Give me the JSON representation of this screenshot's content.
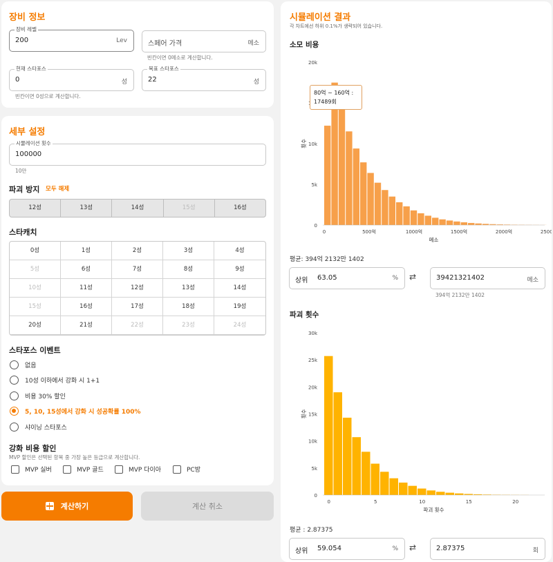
{
  "equip": {
    "title": "장비 정보",
    "level": {
      "label": "장비 레벨",
      "value": "200",
      "unit": "Lev"
    },
    "spare": {
      "placeholder": "스페어 가격",
      "unit": "메소",
      "helper": "빈칸이면 0메소로 계산합니다."
    },
    "current": {
      "label": "현재 스타포스",
      "value": "0",
      "unit": "성",
      "helper": "빈칸이면 0성으로 계산합니다."
    },
    "target": {
      "label": "목표 스타포스",
      "value": "22",
      "unit": "성"
    }
  },
  "detail": {
    "title": "세부 설정",
    "sim_count": {
      "label": "시뮬레이션 횟수",
      "value": "100000",
      "helper": "10만"
    },
    "protect": {
      "title": "파괴 방지",
      "clear_all": "모두 해제",
      "items": [
        "12성",
        "13성",
        "14성",
        "15성",
        "16성"
      ]
    },
    "starcatch": {
      "title": "스타캐치",
      "items": [
        "0성",
        "1성",
        "2성",
        "3성",
        "4성",
        "5성",
        "6성",
        "7성",
        "8성",
        "9성",
        "10성",
        "11성",
        "12성",
        "13성",
        "14성",
        "15성",
        "16성",
        "17성",
        "18성",
        "19성",
        "20성",
        "21성",
        "22성",
        "23성",
        "24성"
      ]
    },
    "event": {
      "title": "스타포스 이벤트",
      "options": [
        "없음",
        "10성 이하에서 강화 시 1+1",
        "비용 30% 할인",
        "5, 10, 15성에서 강화 시 성공확률 100%",
        "샤이닝 스타포스"
      ],
      "selected_index": 3
    },
    "discount": {
      "title": "강화 비용 할인",
      "helper": "MVP 할인은 선택된 항목 중 가장 높은 등급으로 계산합니다.",
      "options": [
        "MVP 실버",
        "MVP 골드",
        "MVP 다이아",
        "PC방"
      ]
    }
  },
  "actions": {
    "calc": "계산하기",
    "cancel": "계산 취소"
  },
  "colors": {
    "accent": "#f57c00",
    "cost_bar": "#f7a04a",
    "destroy_bar": "#ffb300"
  },
  "results": {
    "title": "시뮬레이션 결과",
    "subtitle": "각 차트에선 하위 0.1%가 생략되어 있습니다.",
    "cost": {
      "title": "소모 비용",
      "mean": "평균: 394억 2132만 1402",
      "percentile_label": "상위",
      "percentile": "63.05",
      "percentile_unit": "%",
      "value": "39421321402",
      "value_unit": "메소",
      "value_helper": "394억 2132만 1402",
      "tooltip_line1": "80억 ~ 160억 :",
      "tooltip_line2": "17489회"
    },
    "destroy": {
      "title": "파괴 횟수",
      "mean": "평균 : 2.87375",
      "percentile_label": "상위",
      "percentile": "59.054",
      "percentile_unit": "%",
      "value": "2.87375",
      "value_unit": "회"
    }
  },
  "chart_data": [
    {
      "type": "bar",
      "xlabel": "메소",
      "ylabel": "횟수",
      "ylim": [
        0,
        20000
      ],
      "yticks": [
        "0",
        "5k",
        "10k",
        "15k",
        "20k"
      ],
      "xticks": [
        "0",
        "500억",
        "1000억",
        "1500억",
        "2000억",
        "2500억"
      ],
      "xtick_values": [
        0,
        500,
        1000,
        1500,
        2000,
        2500
      ],
      "bin_width": 80,
      "bin_unit": "억",
      "values": [
        12200,
        17489,
        14500,
        11500,
        9400,
        7700,
        6400,
        5200,
        4300,
        3500,
        2800,
        2300,
        1800,
        1450,
        1150,
        900,
        700,
        560,
        440,
        340,
        260,
        200,
        150,
        110,
        80,
        60,
        45,
        35,
        25,
        18,
        12
      ]
    },
    {
      "type": "bar",
      "xlabel": "파괴 횟수",
      "ylabel": "횟수",
      "ylim": [
        0,
        30000
      ],
      "yticks": [
        "0",
        "5k",
        "10k",
        "15k",
        "20k",
        "25k",
        "30k"
      ],
      "xticks": [
        "0",
        "5",
        "10",
        "15",
        "20"
      ],
      "xtick_values": [
        0,
        5,
        10,
        15,
        20
      ],
      "values": [
        25700,
        19000,
        14300,
        10700,
        8000,
        5800,
        4300,
        3100,
        2300,
        1700,
        1200,
        850,
        600,
        430,
        300,
        200,
        140,
        95,
        65,
        45,
        30,
        20
      ]
    }
  ]
}
